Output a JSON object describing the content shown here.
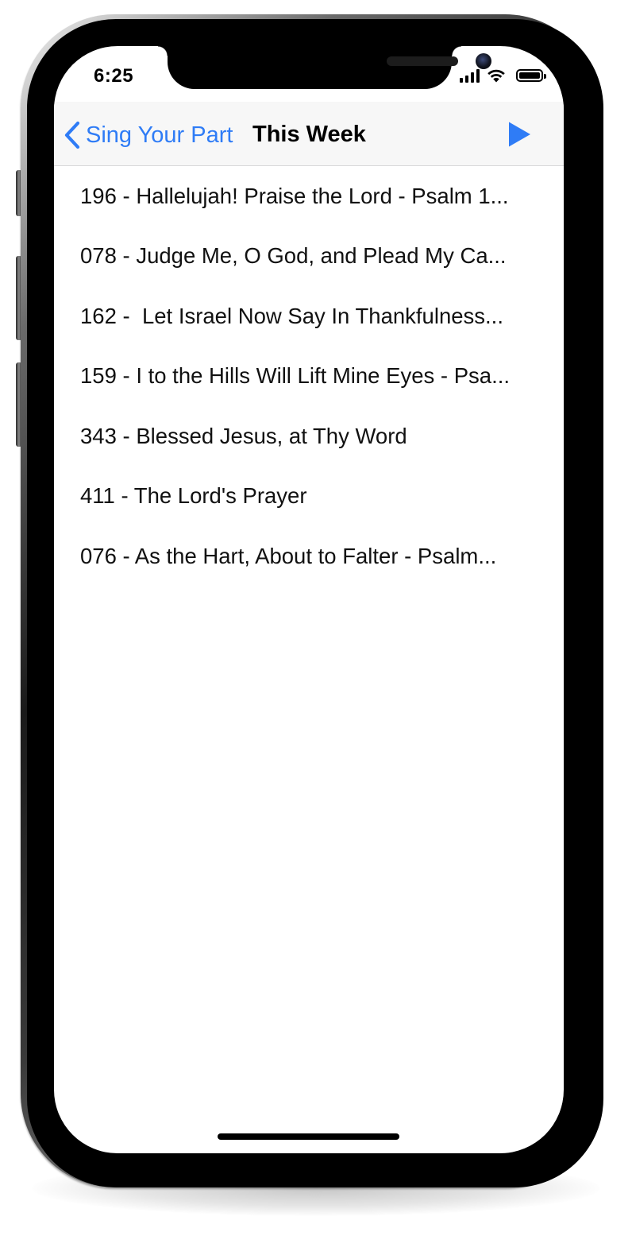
{
  "status_bar": {
    "time": "6:25"
  },
  "nav_bar": {
    "back_label": "Sing Your Part",
    "title": "This Week"
  },
  "songs": [
    "196 - Hallelujah! Praise the Lord - Psalm 1...",
    "078 - Judge Me, O God, and Plead My Ca...",
    "162 -  Let Israel Now Say In Thankfulness...",
    "159 - I to the Hills Will Lift Mine Eyes - Psa...",
    "343 - Blessed Jesus, at Thy Word",
    "411 - The Lord's Prayer",
    "076 - As the Hart, About to Falter - Psalm..."
  ],
  "icons": {
    "back": "chevron-left-icon",
    "play": "play-icon",
    "signal": "cellular-signal-icon",
    "wifi": "wifi-icon",
    "battery": "battery-icon"
  },
  "colors": {
    "accent": "#2f7cf6",
    "nav_background": "#f7f7f7",
    "text": "#111111"
  }
}
